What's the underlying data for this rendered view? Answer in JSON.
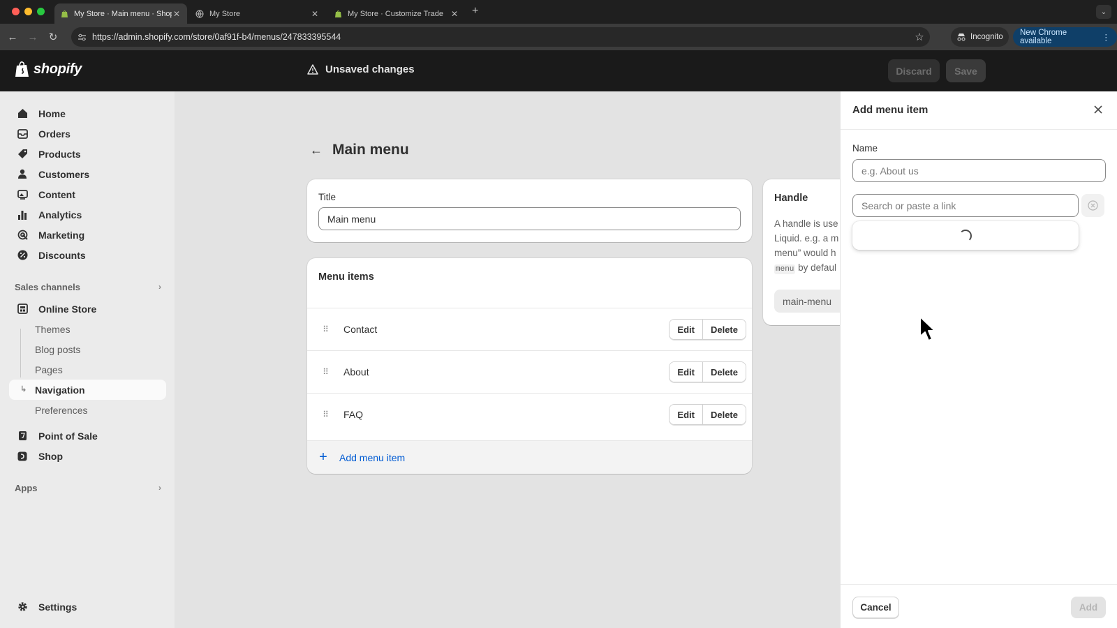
{
  "browser": {
    "tabs": [
      {
        "title": "My Store · Main menu · Shopify",
        "active": true,
        "icon": "shopify-favicon"
      },
      {
        "title": "My Store",
        "active": false,
        "icon": "globe-icon"
      },
      {
        "title": "My Store · Customize Trade",
        "active": false,
        "icon": "shopify-favicon"
      }
    ],
    "url": "https://admin.shopify.com/store/0af91f-b4/menus/247833395544",
    "incognito_label": "Incognito",
    "update_label": "New Chrome available"
  },
  "topbar": {
    "logo_text": "shopify",
    "status": "Unsaved changes",
    "discard_label": "Discard",
    "save_label": "Save"
  },
  "sidebar": {
    "primary": [
      {
        "label": "Home",
        "icon": "home-icon"
      },
      {
        "label": "Orders",
        "icon": "orders-icon"
      },
      {
        "label": "Products",
        "icon": "tag-icon"
      },
      {
        "label": "Customers",
        "icon": "person-icon"
      },
      {
        "label": "Content",
        "icon": "content-icon"
      },
      {
        "label": "Analytics",
        "icon": "bar-chart-icon"
      },
      {
        "label": "Marketing",
        "icon": "target-icon"
      },
      {
        "label": "Discounts",
        "icon": "discount-icon"
      }
    ],
    "sales_channels_label": "Sales channels",
    "online_store": {
      "label": "Online Store",
      "icon": "store-icon"
    },
    "online_store_sub": [
      "Themes",
      "Blog posts",
      "Pages",
      "Navigation",
      "Preferences"
    ],
    "active_sub": "Navigation",
    "channels": [
      {
        "label": "Point of Sale",
        "icon": "pos-icon"
      },
      {
        "label": "Shop",
        "icon": "shop-icon"
      }
    ],
    "apps_label": "Apps",
    "settings_label": "Settings"
  },
  "main": {
    "page_title": "Main menu",
    "title_card": {
      "label": "Title",
      "value": "Main menu"
    },
    "menu_items_card": {
      "title": "Menu items",
      "items": [
        "Contact",
        "About",
        "FAQ"
      ],
      "edit_label": "Edit",
      "delete_label": "Delete",
      "add_label": "Add menu item"
    },
    "handle_card": {
      "title": "Handle",
      "line1": "A handle is use",
      "line2": "Liquid. e.g. a m",
      "line3": "menu” would h",
      "code": "menu",
      "line4_rest": " by defaul",
      "value": "main-menu"
    }
  },
  "panel": {
    "title": "Add menu item",
    "name_label": "Name",
    "name_placeholder": "e.g. About us",
    "link_placeholder": "Search or paste a link",
    "cancel_label": "Cancel",
    "add_label": "Add"
  },
  "colors": {
    "accent_link": "#005bd3",
    "topbar_bg": "#1a1a1a",
    "sidebar_bg": "#ebebeb",
    "main_bg": "#e3e3e3"
  }
}
